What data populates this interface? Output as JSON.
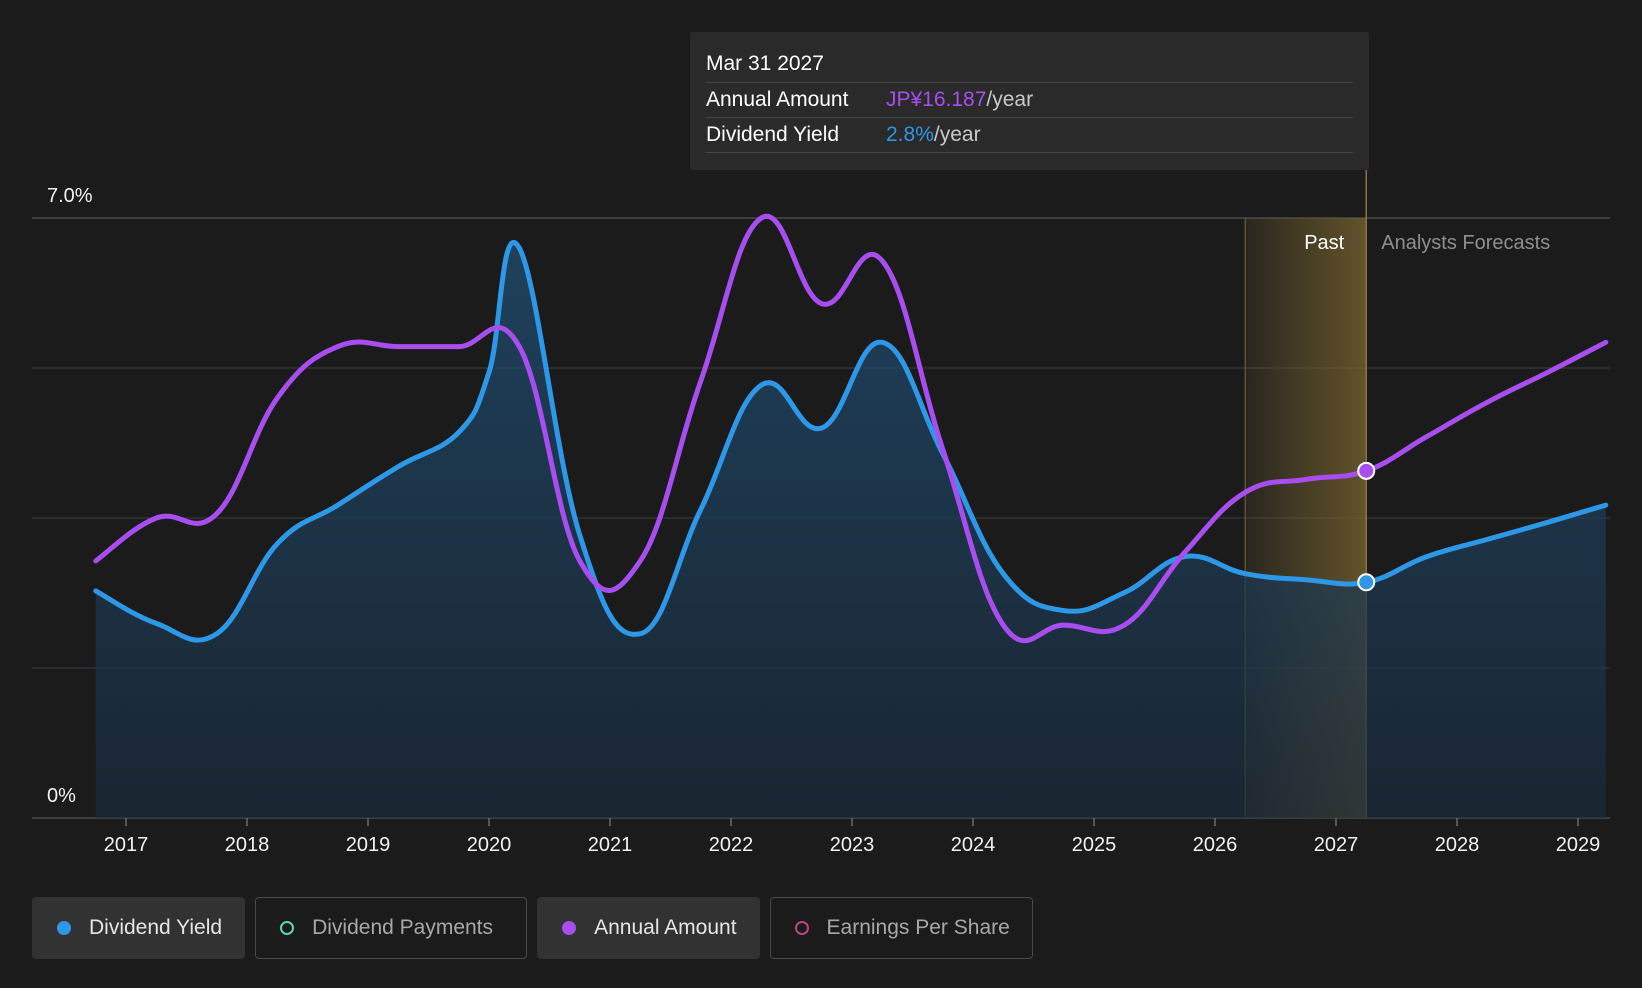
{
  "tooltip": {
    "date": "Mar 31 2027",
    "rows": [
      {
        "label": "Annual Amount",
        "value": "JP¥16.187",
        "unit": "/year"
      },
      {
        "label": "Dividend Yield",
        "value": "2.8%",
        "unit": "/year"
      }
    ]
  },
  "legend": {
    "items": [
      {
        "label": "Dividend Yield",
        "color": "#2d97e8",
        "active": true
      },
      {
        "label": "Dividend Payments",
        "color": "#5fd0c0",
        "active": false
      },
      {
        "label": "Annual Amount",
        "color": "#a84ef0",
        "active": true
      },
      {
        "label": "Earnings Per Share",
        "color": "#c2437a",
        "active": false
      }
    ]
  },
  "chart_data": {
    "type": "line",
    "y_axis": {
      "labels": [
        "7.0%",
        "0%"
      ],
      "ylim": [
        0,
        7.0
      ],
      "unit": "%"
    },
    "x_ticks": [
      "2017",
      "2018",
      "2019",
      "2020",
      "2021",
      "2022",
      "2023",
      "2024",
      "2025",
      "2026",
      "2027",
      "2028",
      "2029"
    ],
    "xlim": [
      2016.75,
      2029.23
    ],
    "grid": true,
    "past_label": "Past",
    "forecast_label": "Analysts Forecasts",
    "past_forecast_boundary": 2027.25,
    "shade_start": 2026.25,
    "series": [
      {
        "name": "Dividend Yield",
        "color": "#2d97e8",
        "fill": true,
        "points": [
          [
            2016.75,
            2.65
          ],
          [
            2017.25,
            2.27
          ],
          [
            2017.75,
            2.15
          ],
          [
            2018.25,
            3.2
          ],
          [
            2018.75,
            3.65
          ],
          [
            2019.25,
            4.1
          ],
          [
            2019.75,
            4.5
          ],
          [
            2020.0,
            5.2
          ],
          [
            2020.25,
            6.65
          ],
          [
            2020.75,
            3.3
          ],
          [
            2021.25,
            2.15
          ],
          [
            2021.75,
            3.6
          ],
          [
            2022.25,
            5.05
          ],
          [
            2022.75,
            4.55
          ],
          [
            2023.25,
            5.55
          ],
          [
            2023.75,
            4.25
          ],
          [
            2024.25,
            2.85
          ],
          [
            2024.75,
            2.42
          ],
          [
            2025.25,
            2.63
          ],
          [
            2025.75,
            3.05
          ],
          [
            2026.25,
            2.85
          ],
          [
            2026.75,
            2.78
          ],
          [
            2027.25,
            2.75
          ],
          [
            2027.75,
            3.05
          ],
          [
            2028.25,
            3.25
          ],
          [
            2028.75,
            3.45
          ],
          [
            2029.23,
            3.65
          ]
        ]
      },
      {
        "name": "Annual Amount",
        "color": "#a84ef0",
        "fill": false,
        "points": [
          [
            2016.75,
            3.0
          ],
          [
            2017.25,
            3.5
          ],
          [
            2017.75,
            3.55
          ],
          [
            2018.25,
            4.9
          ],
          [
            2018.75,
            5.5
          ],
          [
            2019.25,
            5.5
          ],
          [
            2019.75,
            5.5
          ],
          [
            2020.25,
            5.5
          ],
          [
            2020.75,
            3.0
          ],
          [
            2021.25,
            3.0
          ],
          [
            2021.75,
            5.1
          ],
          [
            2022.25,
            7.0
          ],
          [
            2022.75,
            6.0
          ],
          [
            2023.25,
            6.5
          ],
          [
            2023.75,
            4.3
          ],
          [
            2024.25,
            2.25
          ],
          [
            2024.75,
            2.25
          ],
          [
            2025.25,
            2.25
          ],
          [
            2025.75,
            3.1
          ],
          [
            2026.25,
            3.8
          ],
          [
            2026.75,
            3.95
          ],
          [
            2027.25,
            4.05
          ],
          [
            2027.75,
            4.45
          ],
          [
            2028.25,
            4.85
          ],
          [
            2028.75,
            5.2
          ],
          [
            2029.23,
            5.55
          ]
        ]
      }
    ],
    "markers": [
      {
        "series": "Annual Amount",
        "x": 2027.25,
        "y": 4.05
      },
      {
        "series": "Dividend Yield",
        "x": 2027.25,
        "y": 2.75
      }
    ]
  }
}
